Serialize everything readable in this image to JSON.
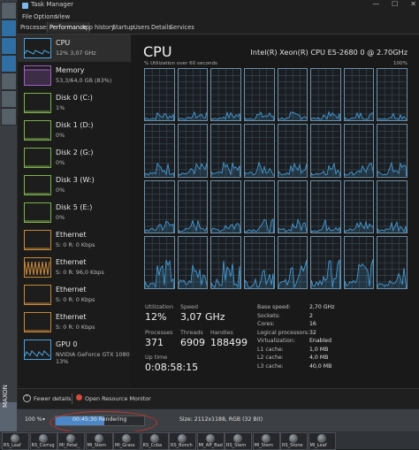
{
  "window": {
    "title": "Task Manager",
    "controls": [
      "—",
      "☐",
      "✕"
    ]
  },
  "menu": [
    "File",
    "Options",
    "View"
  ],
  "tabs": [
    {
      "label": "Processes"
    },
    {
      "label": "Performance",
      "active": true
    },
    {
      "label": "App history"
    },
    {
      "label": "Startup"
    },
    {
      "label": "Users"
    },
    {
      "label": "Details"
    },
    {
      "label": "Services"
    }
  ],
  "sidebar": [
    {
      "name": "CPU",
      "line1": "12%  3,07 GHz",
      "line2": "",
      "selected": true,
      "color": "#4aa3df"
    },
    {
      "name": "Memory",
      "line1": "53,3/64,0 GB (83%)",
      "line2": "",
      "color": "#a35fc7"
    },
    {
      "name": "Disk 0 (C:)",
      "line1": "1%",
      "line2": "",
      "color": "#7fb04a"
    },
    {
      "name": "Disk 1 (D:)",
      "line1": "0%",
      "line2": "",
      "color": "#7fb04a"
    },
    {
      "name": "Disk 2 (G:)",
      "line1": "0%",
      "line2": "",
      "color": "#7fb04a"
    },
    {
      "name": "Disk 3 (W:)",
      "line1": "0%",
      "line2": "",
      "color": "#7fb04a"
    },
    {
      "name": "Disk 5 (E:)",
      "line1": "0%",
      "line2": "",
      "color": "#7fb04a"
    },
    {
      "name": "Ethernet",
      "line1": "S: 0  R: 0 Kbps",
      "line2": "",
      "color": "#c8883a"
    },
    {
      "name": "Ethernet",
      "line1": "S: 0  R: 96,0 Kbps",
      "line2": "",
      "color": "#c8883a"
    },
    {
      "name": "Ethernet",
      "line1": "S: 0  R: 0 Kbps",
      "line2": "",
      "color": "#c8883a"
    },
    {
      "name": "Ethernet",
      "line1": "S: 0  R: 0 Kbps",
      "line2": "",
      "color": "#c8883a"
    },
    {
      "name": "GPU 0",
      "line1": "NVIDIA GeForce GTX 1080",
      "line2": "13%",
      "color": "#4aa3df"
    }
  ],
  "cpu": {
    "title": "CPU",
    "model": "Intel(R) Xeon(R) CPU E5-2680 0 @ 2.70GHz",
    "util_label": "% Utilization over 60 seconds",
    "util_max": "100%",
    "stats": {
      "utilization_label": "Utilization",
      "utilization": "12%",
      "speed_label": "Speed",
      "speed": "3,07 GHz",
      "processes_label": "Processes",
      "processes": "371",
      "threads_label": "Threads",
      "threads": "6909",
      "handles_label": "Handles",
      "handles": "188499",
      "uptime_label": "Up time",
      "uptime": "0:08:58:15"
    },
    "specs": [
      {
        "label": "Base speed:",
        "value": "2,70 GHz"
      },
      {
        "label": "Sockets:",
        "value": "2"
      },
      {
        "label": "Cores:",
        "value": "16"
      },
      {
        "label": "Logical processors:",
        "value": "32"
      },
      {
        "label": "Virtualization:",
        "value": "Enabled"
      },
      {
        "label": "L1 cache:",
        "value": "1,0 MB"
      },
      {
        "label": "L2 cache:",
        "value": "4,0 MB"
      },
      {
        "label": "L3 cache:",
        "value": "40,0 MB"
      }
    ],
    "line_color": "#4aa3df"
  },
  "footer": {
    "fewer": "Fewer details",
    "monitor": "Open Resource Monitor"
  },
  "statusbar": {
    "zoom": "100 %",
    "render": "00:45:30 Rendering",
    "progress": 0.55,
    "size": "Size: 2112x1188, RGB (32 Bit)"
  },
  "materials": [
    "RS_Leaf",
    "RS_Corrug",
    "MI_Petal_",
    "MI_Stem",
    "MI_Grass",
    "RS_Ccba",
    "RS_Bonch",
    "MI_Aff_Bad",
    "RS_Stem",
    "MI_Stem",
    "RS_Stone",
    "MI_Leaf"
  ]
}
